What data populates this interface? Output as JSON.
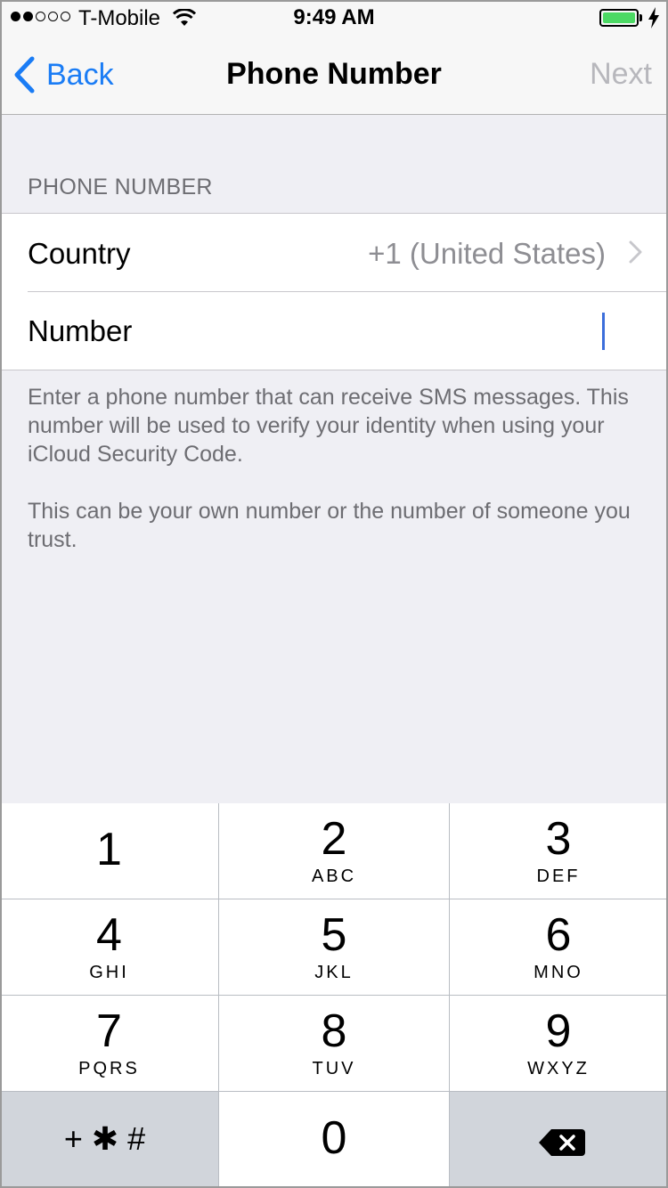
{
  "status_bar": {
    "carrier": "T-Mobile",
    "time": "9:49 AM",
    "signal_bars": 2,
    "battery_color": "#4cd964"
  },
  "nav": {
    "back_label": "Back",
    "title": "Phone Number",
    "next_label": "Next",
    "accent": "#1a7cf5"
  },
  "form": {
    "section_header": "PHONE NUMBER",
    "country_label": "Country",
    "country_value": "+1 (United States)",
    "number_label": "Number",
    "number_value": ""
  },
  "footer": {
    "paragraph1": "Enter a phone number that can receive SMS messages. This number will be used to verify your identity when using your iCloud Security Code.",
    "paragraph2": "This can be your own number or the number of someone you trust."
  },
  "keypad": {
    "keys": [
      {
        "digit": "1",
        "letters": ""
      },
      {
        "digit": "2",
        "letters": "ABC"
      },
      {
        "digit": "3",
        "letters": "DEF"
      },
      {
        "digit": "4",
        "letters": "GHI"
      },
      {
        "digit": "5",
        "letters": "JKL"
      },
      {
        "digit": "6",
        "letters": "MNO"
      },
      {
        "digit": "7",
        "letters": "PQRS"
      },
      {
        "digit": "8",
        "letters": "TUV"
      },
      {
        "digit": "9",
        "letters": "WXYZ"
      },
      {
        "digit": "0",
        "letters": ""
      }
    ],
    "symbols_label": "+✱#",
    "delete_icon": "backspace-icon"
  }
}
